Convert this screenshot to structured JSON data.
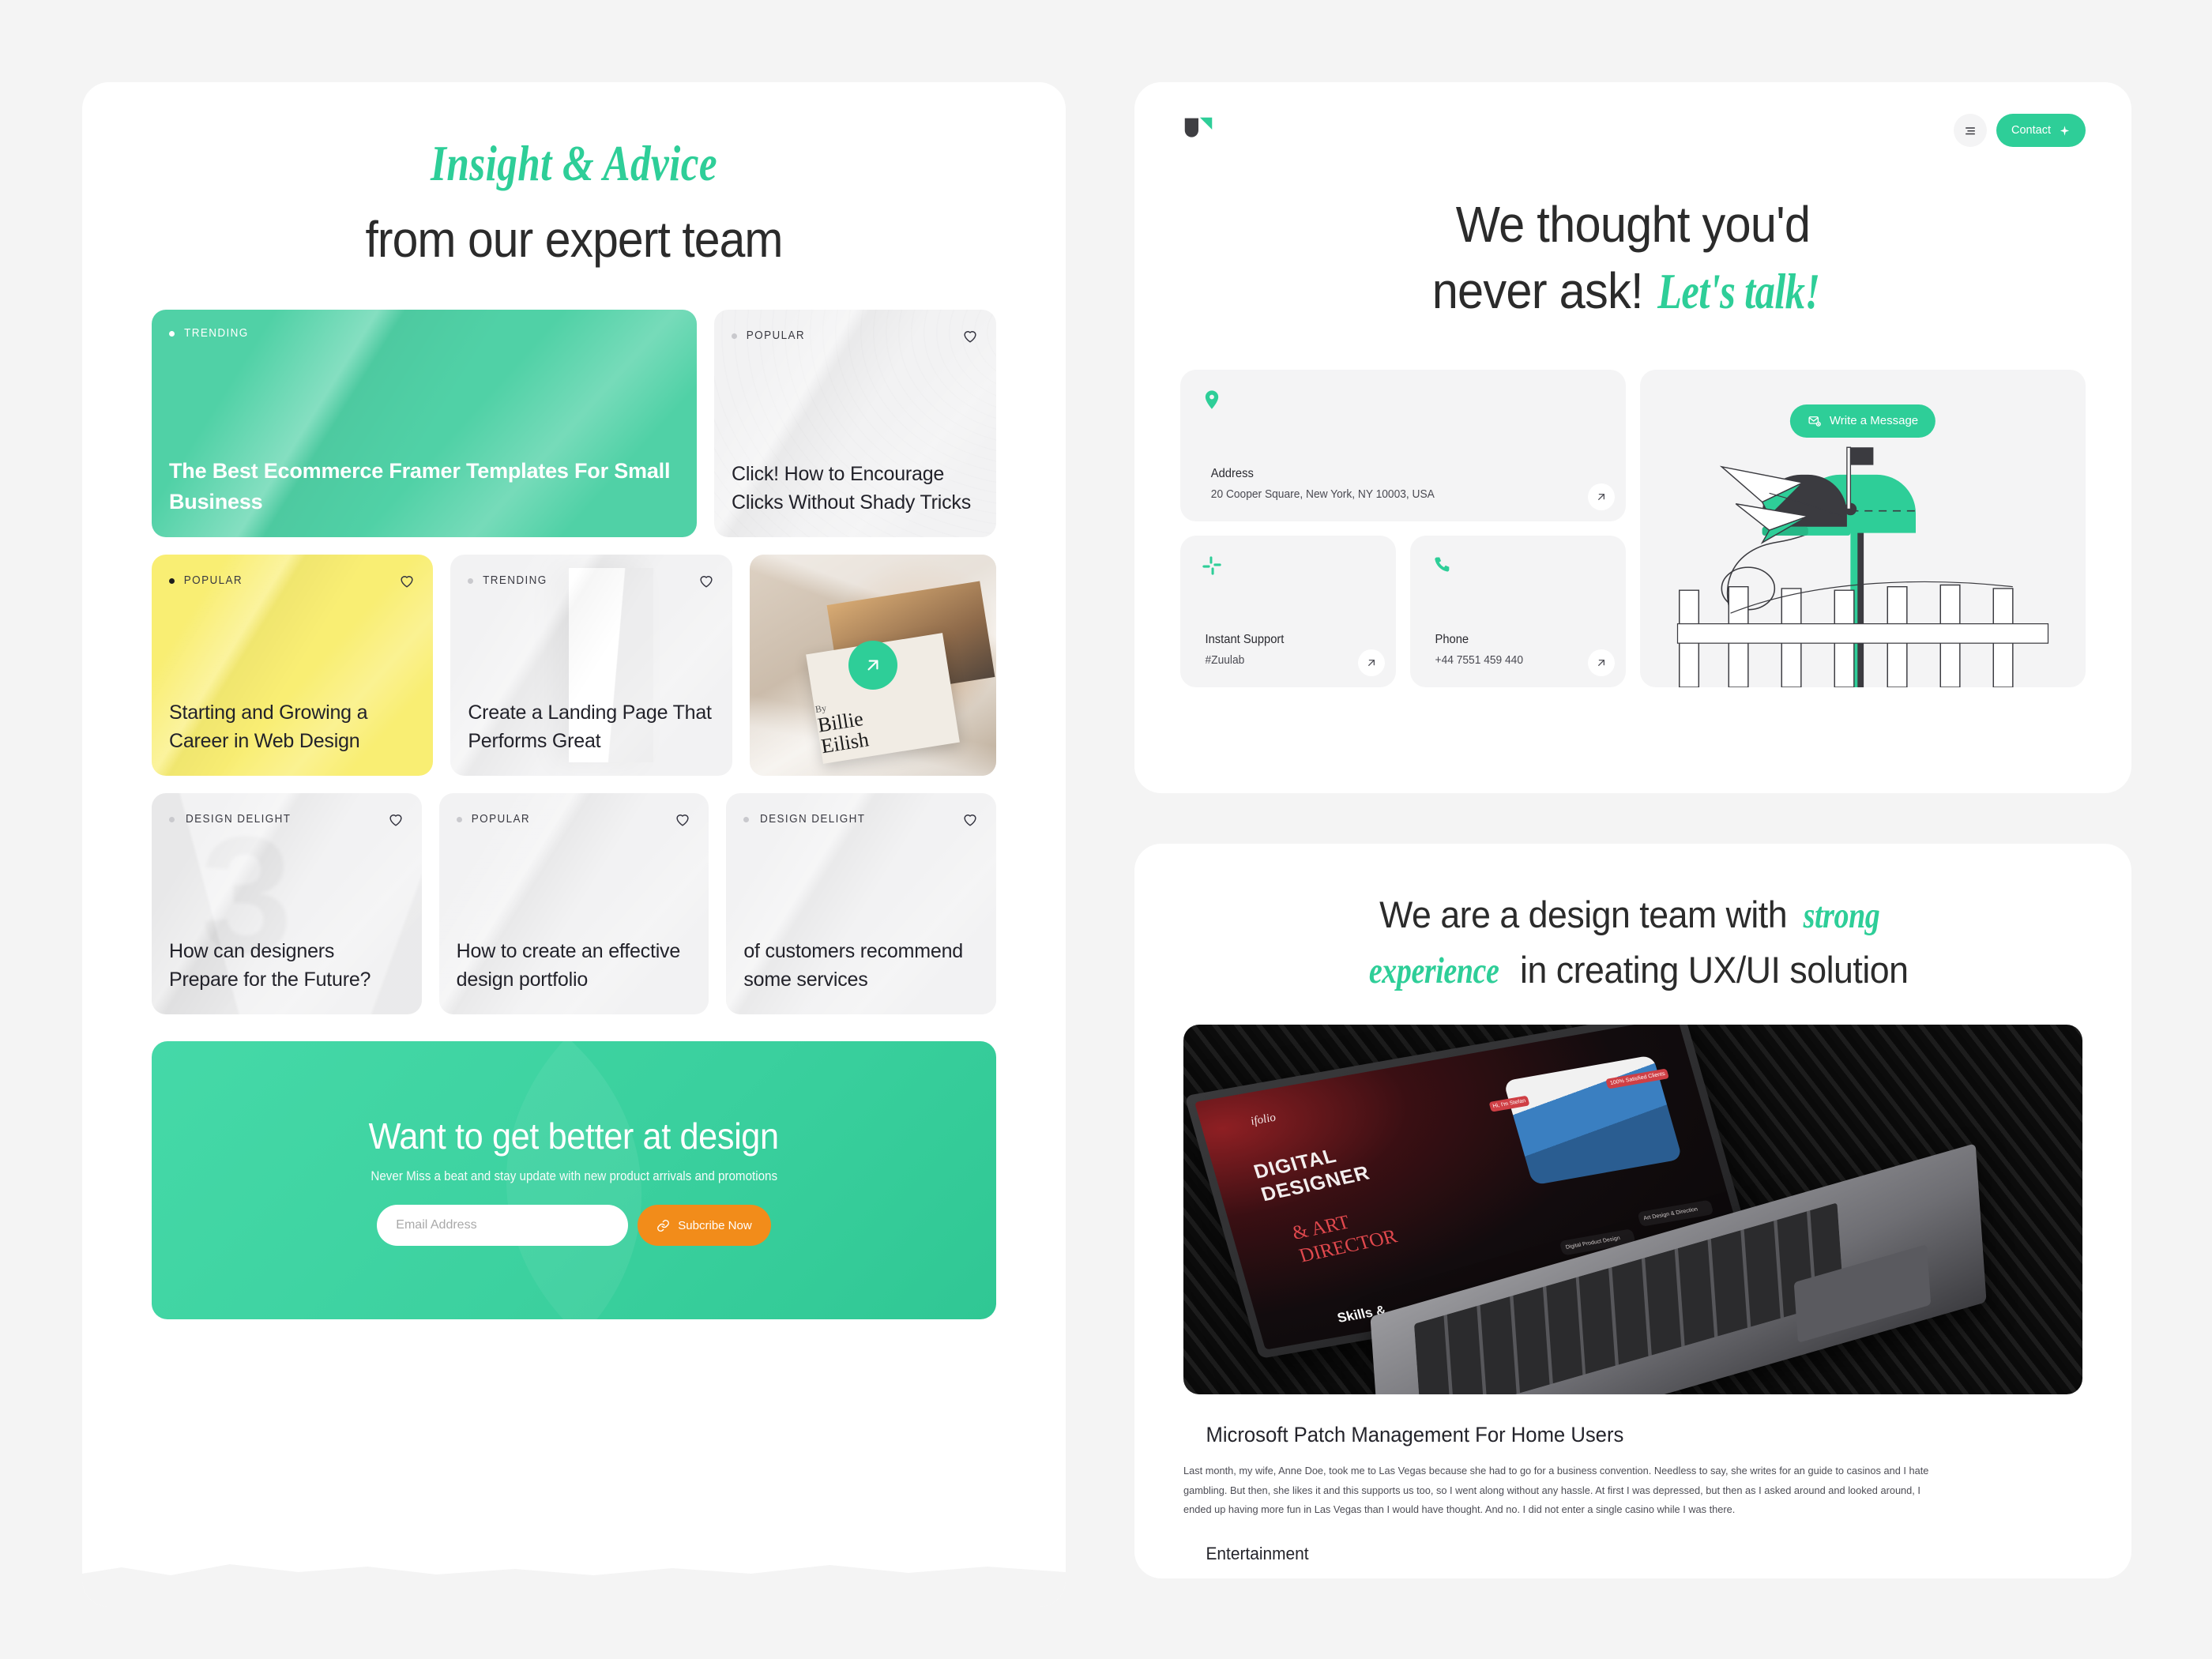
{
  "left_panel": {
    "eyebrow": "Insight & Advice",
    "heading": "from our expert team",
    "cards": [
      {
        "tag": "TRENDING",
        "title": "The Best Ecommerce Framer Templates For Small Business",
        "style": "green",
        "heart": false
      },
      {
        "tag": "POPULAR",
        "title": "Click! How to Encourage Clicks Without Shady Tricks",
        "style": "grey",
        "heart": true
      },
      {
        "tag": "POPULAR",
        "title": "Starting and Growing a Career in Web Design",
        "style": "yellow",
        "heart": true
      },
      {
        "tag": "TRENDING",
        "title": "Create a Landing Page That Performs Great",
        "style": "grey",
        "heart": true
      },
      {
        "tag": "DESIGN DELIGHT",
        "title": "How can designers Prepare for the Future?",
        "style": "grey",
        "heart": true
      },
      {
        "tag": "POPULAR",
        "title": "How to create an effective design portfolio",
        "style": "grey",
        "heart": true
      },
      {
        "tag": "DESIGN DELIGHT",
        "title": "of customers recommend some services",
        "style": "grey",
        "heart": true
      }
    ],
    "photo_card": {
      "by_label": "By",
      "artist_line1": "Billie",
      "artist_line2": "Eilish",
      "arrow_icon": "arrow-up-right-icon"
    },
    "newsletter": {
      "title": "Want to get better at design",
      "subtitle": "Never Miss a beat and stay update with new product arrivals and promotions",
      "email_placeholder": "Email Address",
      "email_value": "",
      "button_label": "Subcribe Now",
      "button_icon": "link-icon",
      "button_color": "#F28C1A"
    }
  },
  "right_top": {
    "logo_name": "brand-logo",
    "menu_icon": "menu-icon",
    "contact_button": "Contact",
    "contact_icon": "sparkle-icon",
    "heading_line1": "We thought you'd",
    "heading_line2_plain": "never ask!",
    "heading_line2_accent": "Let's talk!",
    "contact_cards": [
      {
        "icon": "location-pin-icon",
        "label": "Address",
        "value": "20 Cooper Square, New York, NY 10003, USA",
        "arrow": "arrow-up-right-icon"
      },
      {
        "icon": "slack-icon",
        "label": "Instant Support",
        "value": "#Zuulab",
        "arrow": "arrow-up-right-icon"
      },
      {
        "icon": "phone-icon",
        "label": "Phone",
        "value": "+44 7551 459 440",
        "arrow": "arrow-up-right-icon"
      }
    ],
    "mailbox": {
      "button_label": "Write a Message",
      "button_icon": "mail-star-icon",
      "illustration": "mailbox-with-paper-planes-and-fence"
    }
  },
  "right_bottom": {
    "heading_a": "We are a design team with ",
    "heading_accent_1": "strong",
    "heading_accent_2": "experience",
    "heading_b": " in creating UX/UI solution",
    "laptop_screen": {
      "brand": "ifolio",
      "title_line1": "DIGITAL",
      "title_line2": "DESIGNER",
      "title_accent1": "& ART",
      "title_accent2": "DIRECTOR",
      "tile_1": "Digital Product Design",
      "tile_2": "Art Design & Direction",
      "pill_1": "Hi, I'm Stefan",
      "pill_2": "100% Satisfied Clients",
      "footer": "Skills &"
    },
    "article_title": "Microsoft Patch Management For Home Users",
    "article_body": "Last month, my wife, Anne Doe, took me to Las Vegas because she had to go for a business convention. Needless to say, she writes for an guide to casinos and I hate gambling. But then, she likes it and this supports us too, so I went along without any hassle. At first I was depressed, but then as I asked around and looked around, I ended up having more fun in Las Vegas than I would have thought. And no. I did not enter a single casino while I was there.",
    "article_category": "Entertainment"
  },
  "theme": {
    "background": "#F4F4F4",
    "accent_green": "#2ECE98",
    "card_green": "#50D1A6",
    "card_yellow": "#F9EE73",
    "card_grey": "#F2F2F3",
    "orange": "#F28C1A",
    "text_dark": "#2B2B2B"
  }
}
